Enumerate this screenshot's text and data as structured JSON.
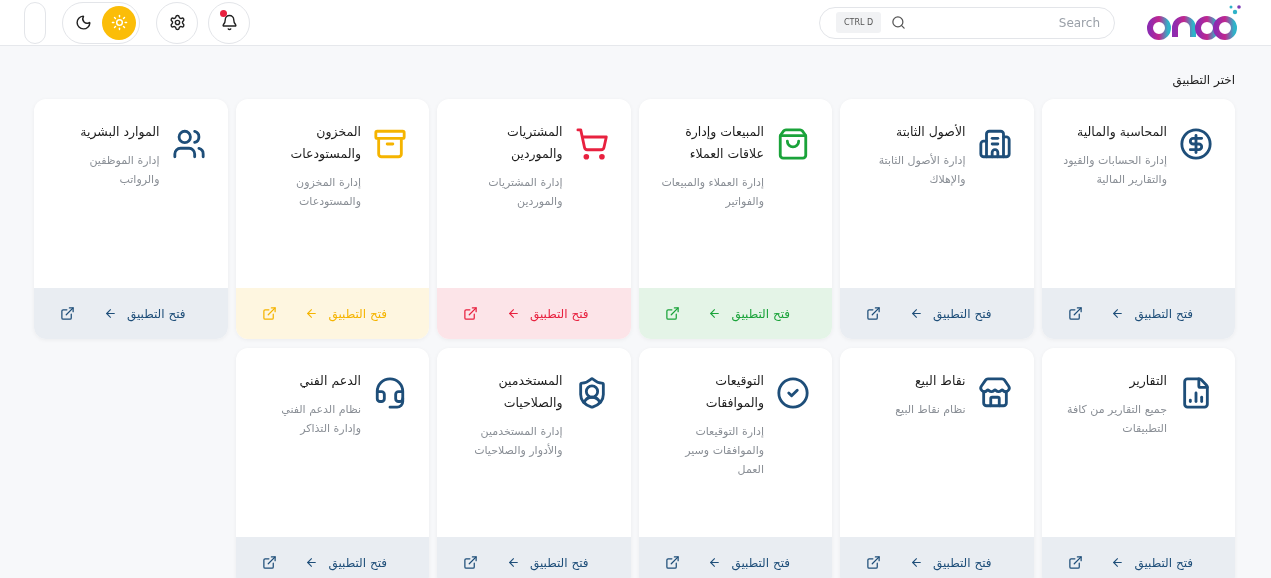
{
  "topbar": {
    "search": {
      "placeholder": "Search",
      "shortcut": "CTRL D"
    },
    "theme_toggle": [
      {
        "kind": "moon",
        "selected": false
      },
      {
        "kind": "sun",
        "selected": true
      }
    ],
    "notifications": {
      "unread": true
    }
  },
  "heading": "اختر التطبيق",
  "apps": [
    {
      "title": "المحاسبة والمالية",
      "description": "إدارة الحسابات والقيود والتقارير المالية",
      "action": "فتح التطبيق",
      "color": "#1e4e79"
    },
    {
      "title": "الأصول الثابتة",
      "description": "إدارة الأصول الثابتة والإهلاك",
      "action": "فتح التطبيق",
      "color": "#1e4e79"
    },
    {
      "title": "المبيعات وإدارة علاقات العملاء",
      "description": "إدارة العملاء والمبيعات والفواتير",
      "action": "فتح التطبيق",
      "color": "#1aa33a"
    },
    {
      "title": "المشتريات والموردين",
      "description": "إدارة المشتريات والموردين",
      "action": "فتح التطبيق",
      "color": "#e8213f"
    },
    {
      "title": "المخزون والمستودعات",
      "description": "إدارة المخزون والمستودعات",
      "action": "فتح التطبيق",
      "color": "#f5b400"
    },
    {
      "title": "الموارد البشرية",
      "description": "إدارة الموظفين والرواتب",
      "action": "فتح التطبيق",
      "color": "#1e4e79"
    },
    {
      "title": "التقارير",
      "description": "جميع التقارير من كافة التطبيقات",
      "action": "فتح التطبيق",
      "color": "#1e4e79"
    },
    {
      "title": "نقاط البيع",
      "description": "نظام نقاط البيع",
      "action": "فتح التطبيق",
      "color": "#1e4e79"
    },
    {
      "title": "التوقيعات والموافقات",
      "description": "إدارة التوقيعات والموافقات وسير العمل",
      "action": "فتح التطبيق",
      "color": "#1e4e79"
    },
    {
      "title": "المستخدمين والصلاحيات",
      "description": "إدارة المستخدمين والأدوار والصلاحيات",
      "action": "فتح التطبيق",
      "color": "#1e4e79"
    },
    {
      "title": "الدعم الفني",
      "description": "نظام الدعم الفني وإدارة التذاكر",
      "action": "فتح التطبيق",
      "color": "#1e4e79"
    }
  ]
}
